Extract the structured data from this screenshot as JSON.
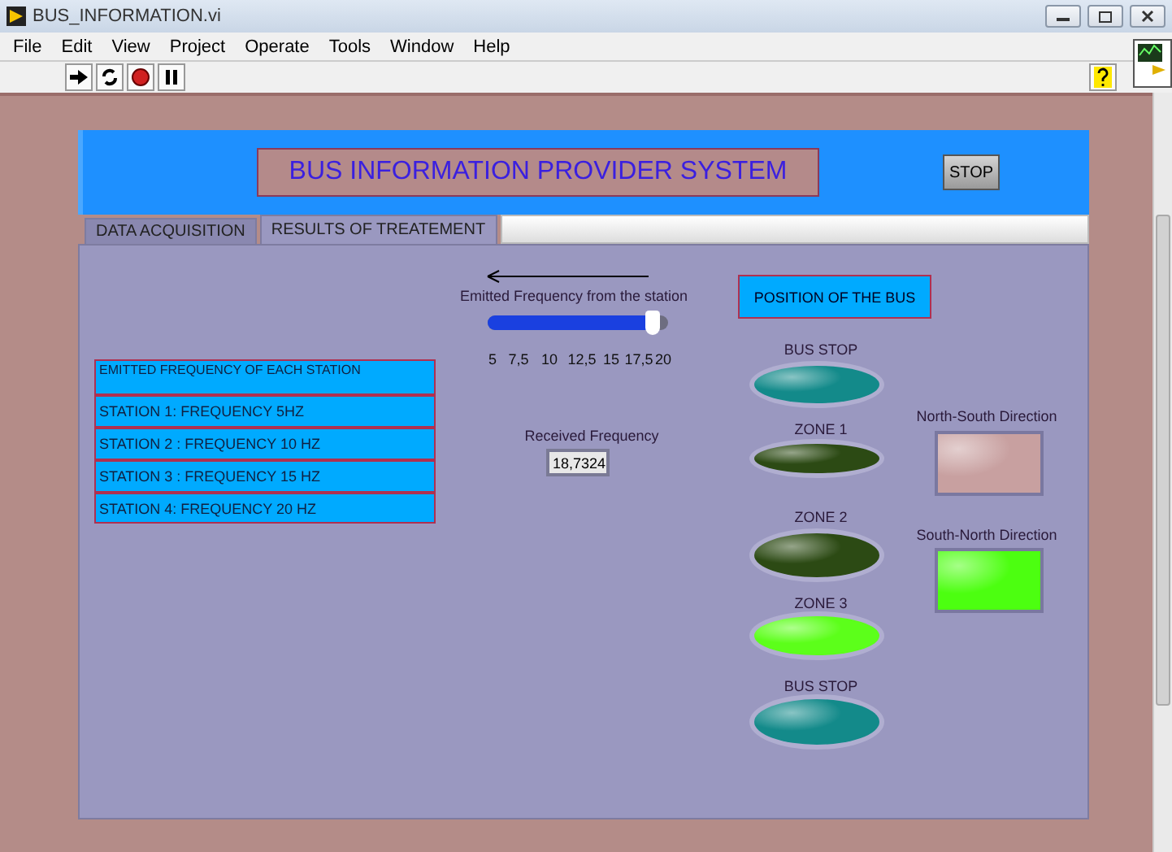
{
  "window": {
    "title": "BUS_INFORMATION.vi"
  },
  "menu": [
    "File",
    "Edit",
    "View",
    "Project",
    "Operate",
    "Tools",
    "Window",
    "Help"
  ],
  "header": {
    "title": "BUS INFORMATION PROVIDER SYSTEM",
    "stop_button": "STOP"
  },
  "tabs": [
    {
      "label": "DATA ACQUISITION",
      "selected": false
    },
    {
      "label": "RESULTS OF TREATEMENT",
      "selected": true
    }
  ],
  "slider": {
    "label": "Emitted Frequency from the station",
    "level": 0.915,
    "ticks": [
      "5",
      "7,5",
      "10",
      "12,5",
      "15",
      "17,5",
      "20"
    ]
  },
  "station_table": {
    "header": "EMITTED FREQUENCY  OF EACH STATION",
    "rows": [
      "STATION 1: FREQUENCY 5HZ",
      "STATION  2 : FREQUENCY 10 HZ",
      "STATION 3 : FREQUENCY 15 HZ",
      "STATION 4:  FREQUENCY 20 HZ"
    ]
  },
  "received_frequency": {
    "label": "Received Frequency",
    "value": "18,7324"
  },
  "position": {
    "title": "POSITION OF THE BUS",
    "leds": [
      {
        "label": "BUS STOP",
        "kind": "stop",
        "on": false
      },
      {
        "label": "ZONE 1",
        "kind": "zone",
        "on": false
      },
      {
        "label": "ZONE 2",
        "kind": "zone",
        "on": false
      },
      {
        "label": "ZONE 3",
        "kind": "zone",
        "on": true
      },
      {
        "label": "BUS STOP",
        "kind": "stop",
        "on": false
      }
    ]
  },
  "directions": [
    {
      "label": "North-South  Direction",
      "on": false
    },
    {
      "label": "South-North Direction",
      "on": true
    }
  ]
}
